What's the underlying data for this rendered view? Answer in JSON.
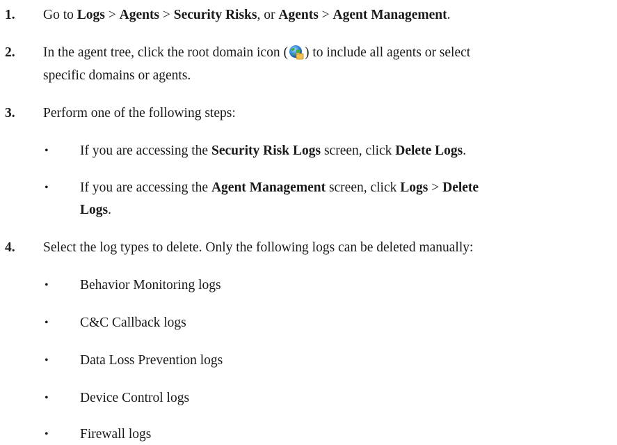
{
  "steps": [
    {
      "number": "1.",
      "parts": [
        "Go to ",
        "Logs",
        " > ",
        "Agents",
        " > ",
        "Security Risks",
        ", or ",
        "Agents",
        " > ",
        "Agent Management",
        "."
      ]
    },
    {
      "number": "2.",
      "line1_a": "In the agent tree, click the root domain icon (",
      "line1_b": ") to include all agents or select",
      "line2": "specific domains or agents.",
      "icon": "root-domain-globe-icon"
    },
    {
      "number": "3.",
      "text": "Perform one of the following steps:",
      "bullets": [
        {
          "parts": [
            "If you are accessing the ",
            "Security Risk Logs",
            " screen, click ",
            "Delete Logs",
            "."
          ]
        },
        {
          "line1_parts": [
            "If you are accessing the ",
            "Agent Management",
            " screen, click ",
            "Logs",
            " > ",
            "Delete"
          ],
          "line2_parts": [
            "Logs",
            "."
          ]
        }
      ]
    },
    {
      "number": "4.",
      "text": "Select the log types to delete. Only the following logs can be deleted manually:",
      "bullets": [
        "Behavior Monitoring logs",
        "C&C Callback logs",
        "Data Loss Prevention logs",
        "Device Control logs",
        "Firewall logs"
      ]
    }
  ],
  "bullet_char": "•"
}
